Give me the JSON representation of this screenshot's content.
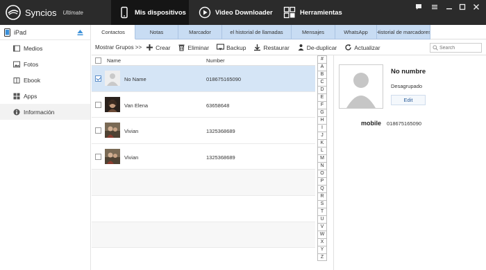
{
  "app": {
    "name": "Syncios",
    "edition": "Ultimate"
  },
  "nav": {
    "tabs": [
      {
        "label": "Mis dispositivos"
      },
      {
        "label": "Video Downloader"
      },
      {
        "label": "Herramientas"
      }
    ]
  },
  "window_controls": [
    "chat-icon",
    "menu-icon",
    "minimize-icon",
    "maximize-icon",
    "close-icon"
  ],
  "sidebar": {
    "device": "iPad",
    "items": [
      {
        "label": "Medios",
        "icon": "media-icon"
      },
      {
        "label": "Fotos",
        "icon": "photos-icon"
      },
      {
        "label": "Ebook",
        "icon": "ebook-icon"
      },
      {
        "label": "Apps",
        "icon": "apps-icon"
      },
      {
        "label": "Información",
        "icon": "info-icon"
      }
    ]
  },
  "tabs": [
    {
      "label": "Contactos"
    },
    {
      "label": "Notas"
    },
    {
      "label": "Marcador"
    },
    {
      "label": "el historial de llamadas"
    },
    {
      "label": "Mensajes"
    },
    {
      "label": "WhatsApp"
    },
    {
      "label": "Historial de marcadores"
    }
  ],
  "toolbar": {
    "groups_label": "Mostrar Grupos >>",
    "create": "Crear",
    "delete": "Eliminar",
    "backup": "Backup",
    "restore": "Restaurar",
    "dedupe": "De-duplicar",
    "refresh": "Actualizar",
    "search_placeholder": "Search"
  },
  "list": {
    "columns": {
      "name": "Name",
      "number": "Number"
    },
    "rows": [
      {
        "name": "No Name",
        "number": "018675165090",
        "selected": true
      },
      {
        "name": "Van Elena",
        "number": "63658648",
        "selected": false
      },
      {
        "name": "Vivian",
        "number": "1325368689",
        "selected": false
      },
      {
        "name": "Vivian",
        "number": "1325368689",
        "selected": false
      }
    ]
  },
  "alphabet": [
    "#",
    "A",
    "B",
    "C",
    "D",
    "E",
    "F",
    "G",
    "H",
    "I",
    "J",
    "K",
    "L",
    "M",
    "N",
    "O",
    "P",
    "Q",
    "R",
    "S",
    "T",
    "U",
    "V",
    "W",
    "X",
    "Y",
    "Z"
  ],
  "detail": {
    "name": "No numbre",
    "group": "Desagrupado",
    "edit_label": "Edit",
    "mobile_label": "mobile",
    "mobile_value": "018675165090"
  },
  "colors": {
    "titlebar": "#2b2b2b",
    "nav_active": "#151515",
    "tab_inactive": "#c8dcf3",
    "row_selected": "#d5e5f6",
    "accent": "#2d6fbe"
  }
}
